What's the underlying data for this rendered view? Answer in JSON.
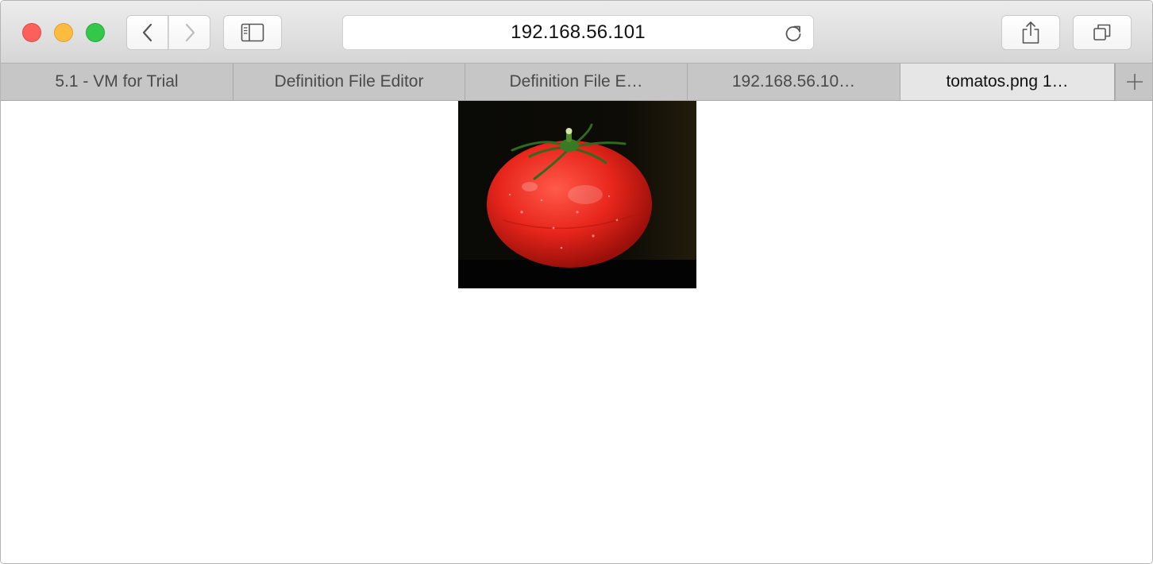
{
  "toolbar": {
    "address": "192.168.56.101",
    "icons": {
      "back": "chevron-left-icon",
      "forward": "chevron-right-icon",
      "sidebar": "sidebar-icon",
      "reload": "reload-icon",
      "share": "share-icon",
      "tabs": "tab-overview-icon"
    }
  },
  "tabs": [
    {
      "label": "5.1 - VM for Trial",
      "active": false
    },
    {
      "label": "Definition File Editor",
      "active": false
    },
    {
      "label": "Definition File E…",
      "active": false
    },
    {
      "label": "192.168.56.10…",
      "active": false
    },
    {
      "label": "tomatos.png 1…",
      "active": true
    }
  ],
  "content": {
    "image_subject": "red tomato on black background"
  },
  "colors": {
    "close": "#fc605c",
    "minimize": "#fdbc40",
    "maximize": "#34c84a",
    "tomato": "#e8261c"
  }
}
